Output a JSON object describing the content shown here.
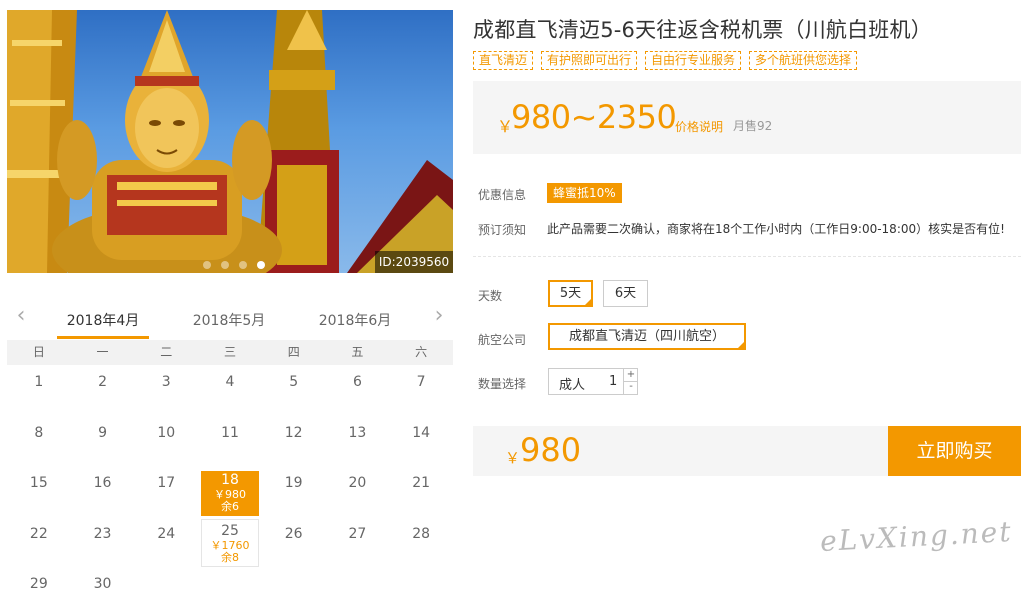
{
  "hero": {
    "photo_id": "ID:2039560",
    "slide_count": 4,
    "active_slide": 4
  },
  "calendar": {
    "prev_icon": "chevron-left-icon",
    "next_icon": "chevron-right-icon",
    "months": [
      "2018年4月",
      "2018年5月",
      "2018年6月"
    ],
    "active_month_index": 0,
    "weekdays": [
      "日",
      "一",
      "二",
      "三",
      "四",
      "五",
      "六"
    ],
    "weeks": [
      [
        {
          "d": "1"
        },
        {
          "d": "2"
        },
        {
          "d": "3"
        },
        {
          "d": "4"
        },
        {
          "d": "5"
        },
        {
          "d": "6"
        },
        {
          "d": "7"
        }
      ],
      [
        {
          "d": "8"
        },
        {
          "d": "9"
        },
        {
          "d": "10"
        },
        {
          "d": "11"
        },
        {
          "d": "12"
        },
        {
          "d": "13"
        },
        {
          "d": "14"
        }
      ],
      [
        {
          "d": "15"
        },
        {
          "d": "16"
        },
        {
          "d": "17"
        },
        {
          "d": "18",
          "price": "￥980",
          "stock": "余6",
          "state": "selected"
        },
        {
          "d": "19"
        },
        {
          "d": "20"
        },
        {
          "d": "21"
        }
      ],
      [
        {
          "d": "22"
        },
        {
          "d": "23"
        },
        {
          "d": "24"
        },
        {
          "d": "25",
          "price": "￥1760",
          "stock": "余8",
          "state": "available"
        },
        {
          "d": "26"
        },
        {
          "d": "27"
        },
        {
          "d": "28"
        }
      ],
      [
        {
          "d": "29"
        },
        {
          "d": "30"
        }
      ]
    ]
  },
  "product": {
    "title": "成都直飞清迈5-6天往返含税机票（川航白班机）",
    "tags": [
      "直飞清迈",
      "有护照即可出行",
      "自由行专业服务",
      "多个航班供您选择"
    ],
    "price_yen": "￥",
    "price_range": "980~2350",
    "price_explain": "价格说明",
    "monthly_sales": "月售92"
  },
  "info": {
    "promo_label": "优惠信息",
    "promo_badge": "蜂蜜抵10%",
    "notice_label": "预订须知",
    "notice_text": "此产品需要二次确认，商家将在18个工作小时内（工作日9:00-18:00）核实是否有位!"
  },
  "options": {
    "days_label": "天数",
    "days": [
      "5天",
      "6天"
    ],
    "days_selected": 0,
    "airline_label": "航空公司",
    "airline": "成都直飞清迈（四川航空）",
    "qty_label": "数量选择",
    "qty_type": "成人",
    "qty_value": "1",
    "qty_plus": "+",
    "qty_minus": "-"
  },
  "purchase": {
    "yen": "￥",
    "total": "980",
    "buy_label": "立即购买"
  },
  "watermark": "eLvXing.net",
  "colors": {
    "accent": "#f39800",
    "panel": "#f5f5f5"
  }
}
